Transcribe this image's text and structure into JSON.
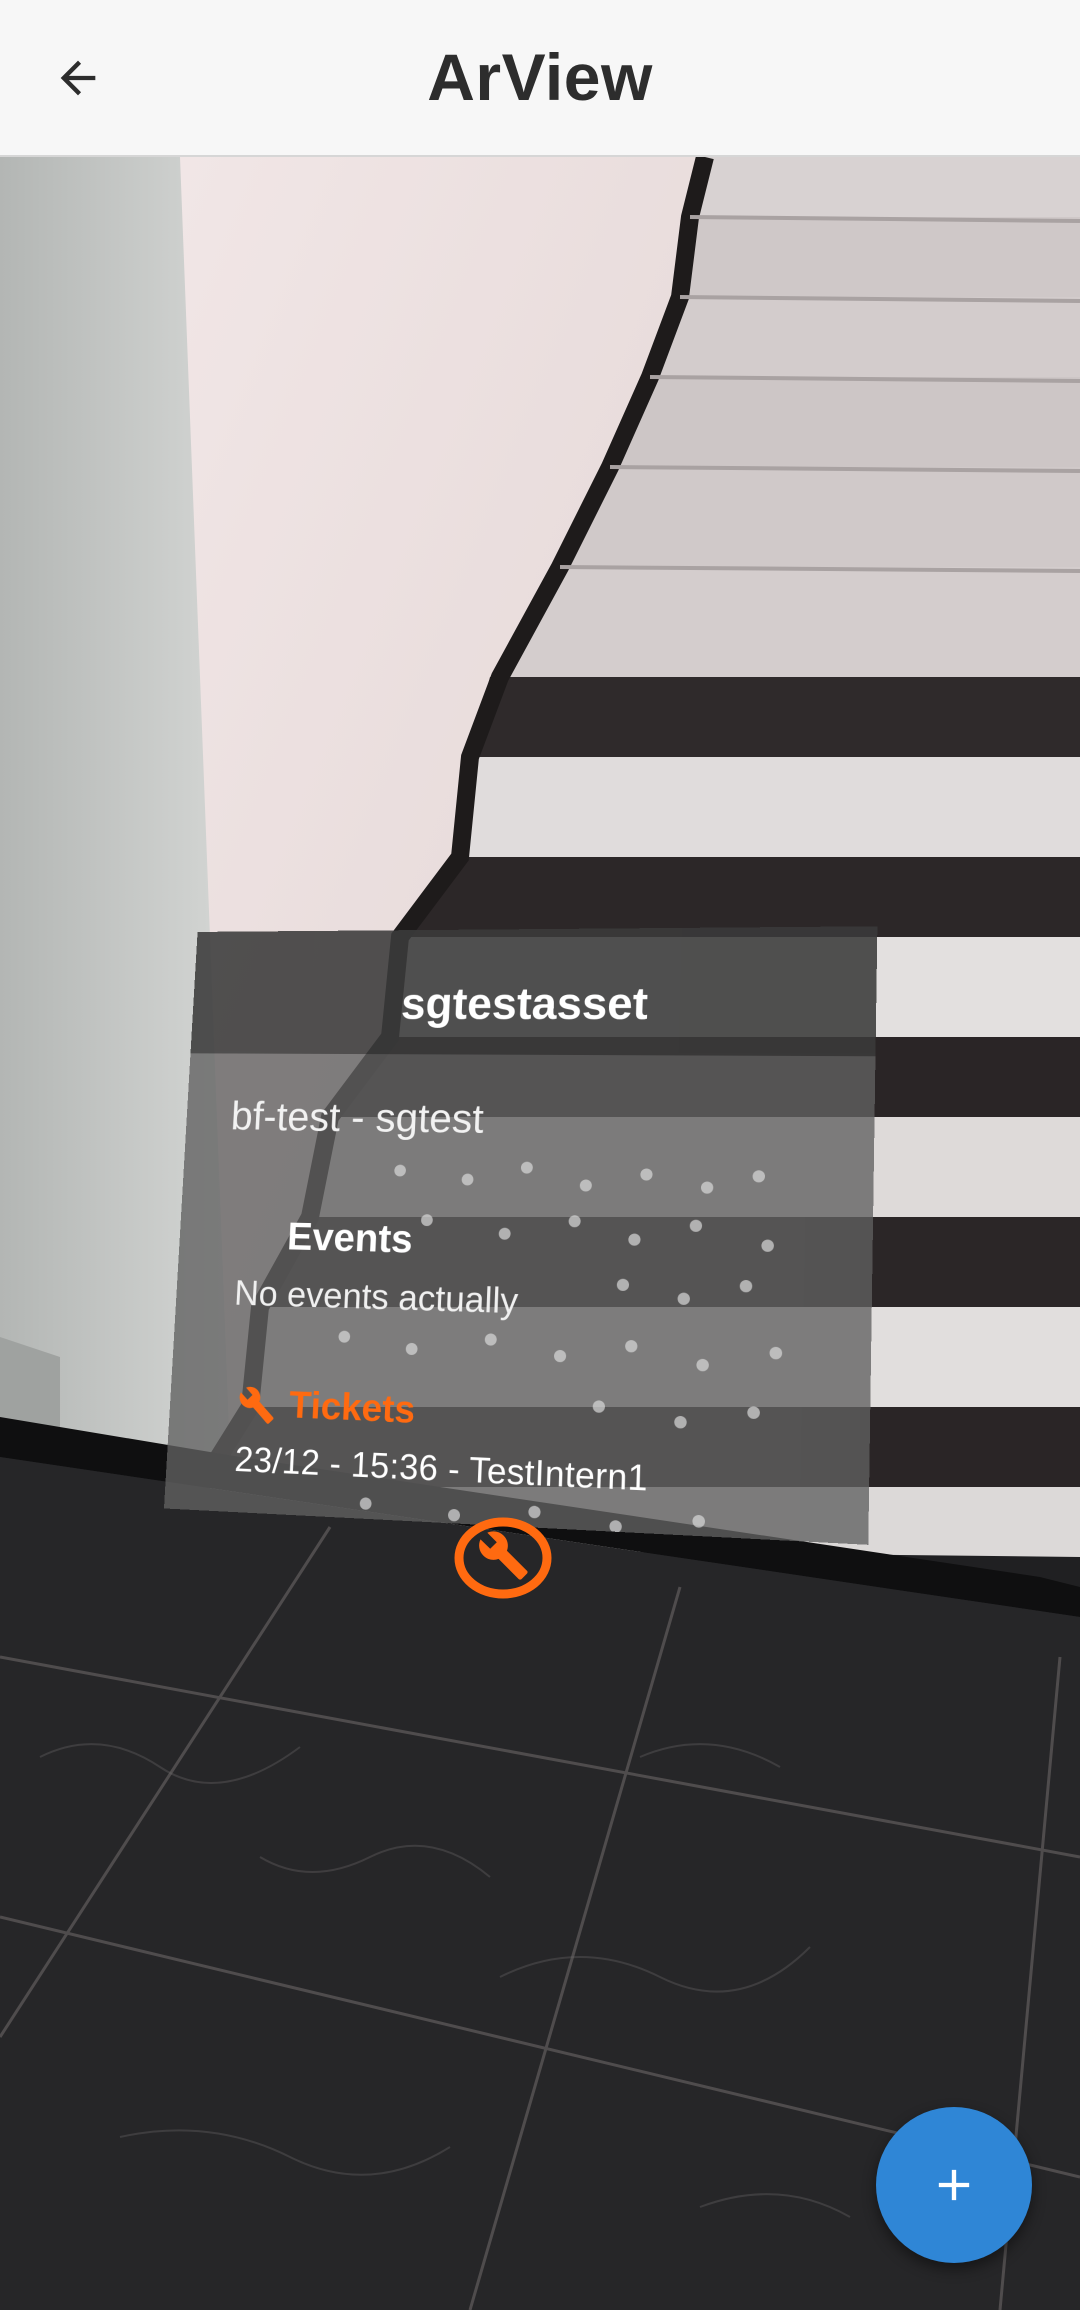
{
  "app_bar": {
    "title": "ArView",
    "back_icon": "arrow-left-icon"
  },
  "ar_card": {
    "asset_name": "sgtestasset",
    "subtitle": "bf-test - sgtest",
    "events": {
      "heading": "Events",
      "text": "No events actually"
    },
    "tickets": {
      "heading": "Tickets",
      "icon": "wrench-icon",
      "entry": "23/12 - 15:36 - TestIntern1"
    }
  },
  "anchor_marker": {
    "icon": "wrench-icon"
  },
  "fab": {
    "icon": "plus-icon"
  },
  "colors": {
    "app_bar_bg": "#f7f7f7",
    "title_text": "#2d2d2d",
    "accent_orange": "#ff6a10",
    "fab_blue": "#2f86d6"
  }
}
